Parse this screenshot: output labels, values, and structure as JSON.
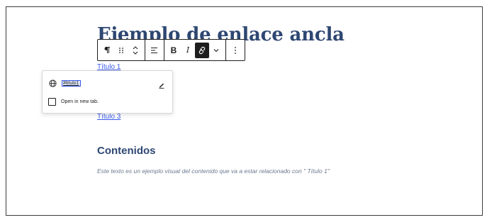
{
  "post": {
    "title": "Ejemplo de enlace ancla",
    "links": [
      "Título 1",
      "Título 3"
    ],
    "heading": "Contenidos",
    "paragraph": "Este texto es un ejemplo visual del contenido que va a estar relacionado con \" Título 1\""
  },
  "toolbar": {
    "paragraph_icon": "paragraph-icon",
    "drag_icon": "drag-handle-icon",
    "move_icon": "move-up-down-icon",
    "align_icon": "align-left-icon",
    "bold_label": "B",
    "italic_label": "I",
    "link_icon": "unlink-icon",
    "more_rich_text_icon": "chevron-down-icon",
    "options_icon": "more-vertical-icon"
  },
  "link_popover": {
    "url": "#titulo1",
    "open_new_tab_label": "Open in new tab.",
    "open_new_tab_checked": false,
    "globe_icon": "globe-icon",
    "edit_icon": "pencil-icon"
  },
  "colors": {
    "title": "#2e4772",
    "link": "#3858e9",
    "toolbar_active": "#1e1e1e",
    "paragraph": "#6b7a90"
  }
}
